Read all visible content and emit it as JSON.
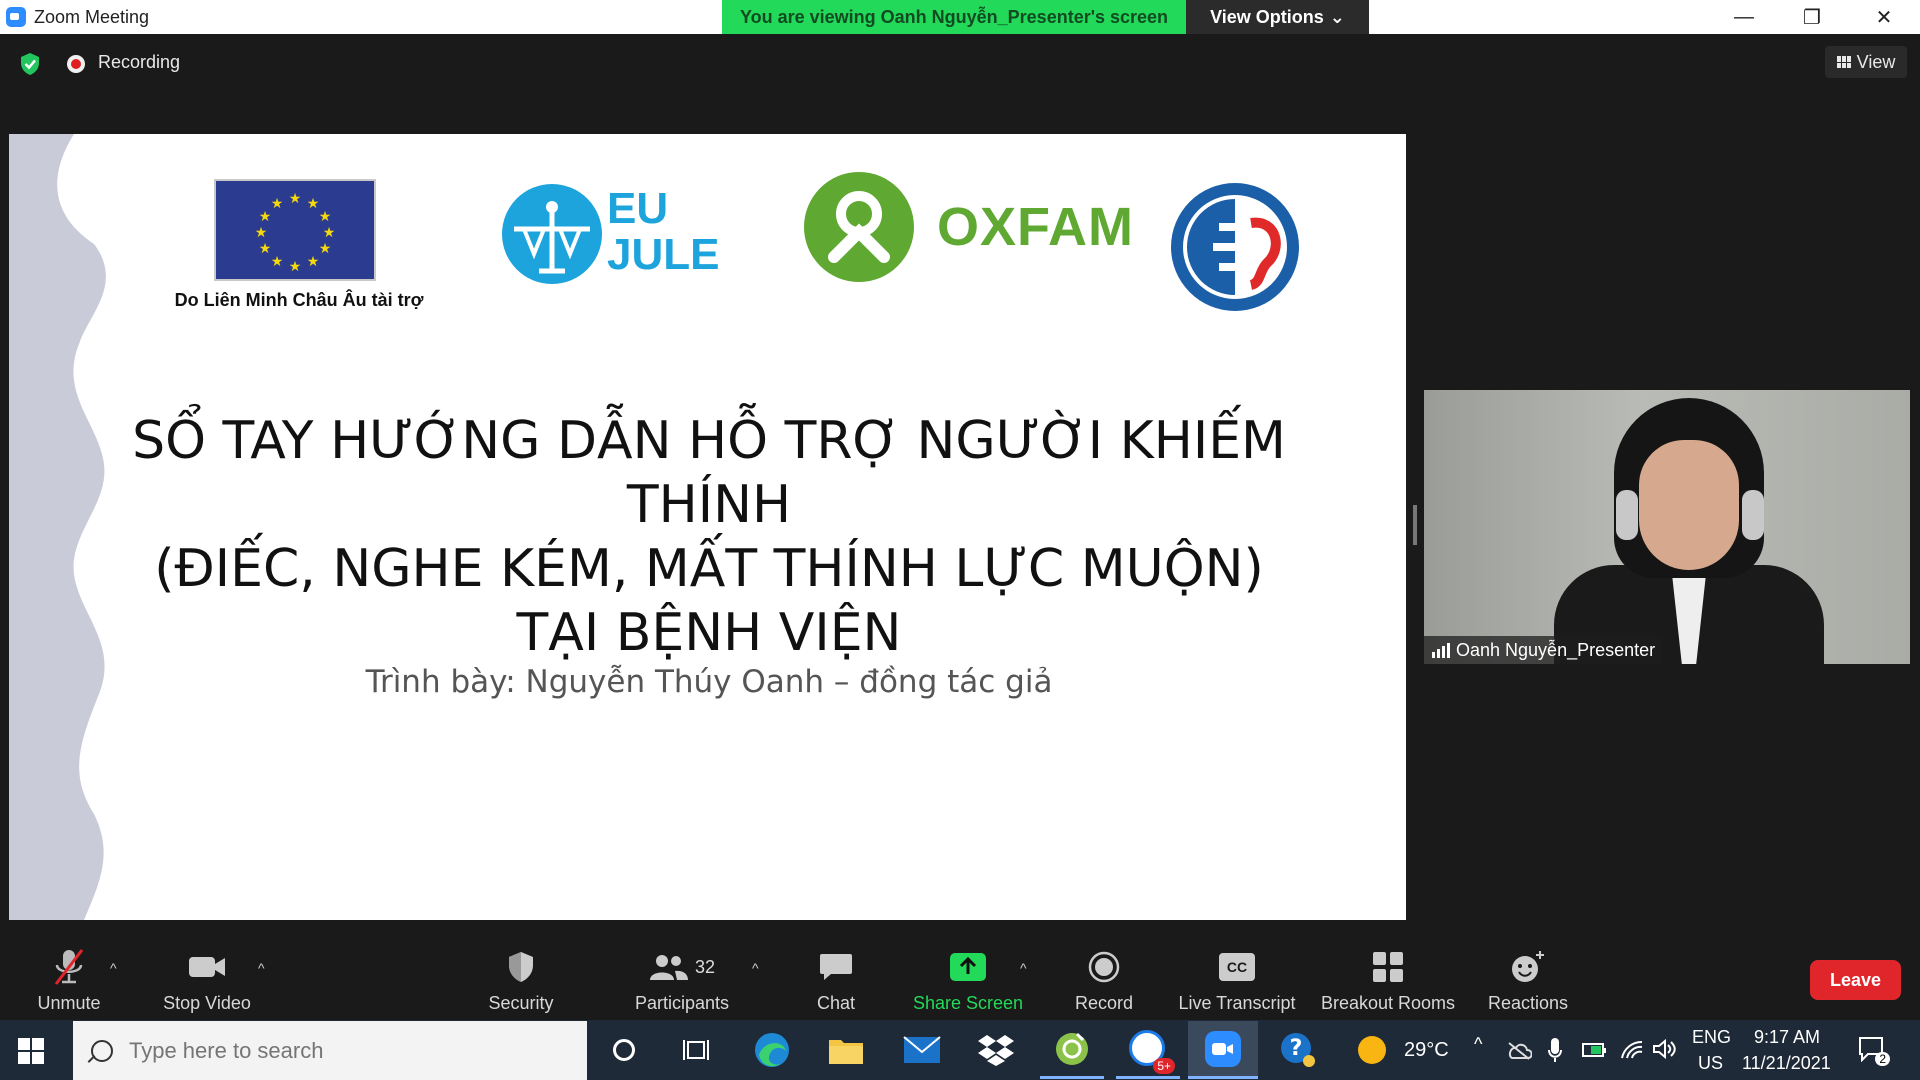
{
  "window": {
    "title": "Zoom Meeting",
    "viewing_banner": "You are viewing Oanh Nguyễn_Presenter's screen",
    "view_options": "View Options",
    "minimize": "—",
    "restore": "❐",
    "close": "✕"
  },
  "meeting_header": {
    "recording_label": "Recording",
    "view_label": "View"
  },
  "slide": {
    "eu_caption": "Do Liên Minh Châu Âu tài trợ",
    "eujule_line1": "EU",
    "eujule_line2": "JULE",
    "oxfam_text": "OXFAM",
    "title_line1": "SỔ TAY HƯỚNG DẪN HỖ TRỢ NGƯỜI KHIẾM THÍNH",
    "title_line2": "(ĐIẾC, NGHE KÉM, MẤT THÍNH LỰC MUỘN)",
    "title_line3": "TẠI BỆNH VIỆN",
    "subtitle": "Trình bày: Nguyễn Thúy Oanh – đồng tác giả"
  },
  "video": {
    "participant_name": "Oanh Nguyễn_Presenter"
  },
  "toolbar": {
    "unmute": "Unmute",
    "stop_video": "Stop Video",
    "security": "Security",
    "participants": "Participants",
    "participants_count": "32",
    "chat": "Chat",
    "share_screen": "Share Screen",
    "record": "Record",
    "live_transcript": "Live Transcript",
    "live_transcript_icon_text": "CC",
    "breakout_rooms": "Breakout Rooms",
    "reactions": "Reactions",
    "leave": "Leave"
  },
  "taskbar": {
    "search_placeholder": "Type here to search",
    "zalo_badge": "5+",
    "weather_temp": "29°C",
    "lang_top": "ENG",
    "lang_bottom": "US",
    "time": "9:17 AM",
    "date": "11/21/2021",
    "notification_count": "2"
  },
  "colors": {
    "banner_green": "#23d959",
    "share_green": "#23d959",
    "leave_red": "#e0262b",
    "eu_blue": "#2b3b8f",
    "oxfam_green": "#5fa832",
    "eujule_blue": "#1ea4dc",
    "taskbar_bg": "#1e2a38"
  }
}
